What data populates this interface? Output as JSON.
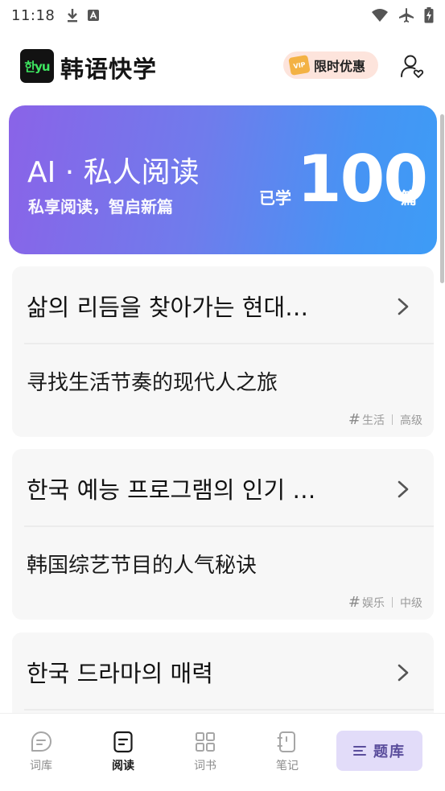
{
  "status_bar": {
    "time": "11:18",
    "left_icons": [
      "download-icon",
      "app-notification-icon"
    ],
    "right_icons": [
      "wifi-icon",
      "airplane-mode-icon",
      "battery-charging-icon"
    ]
  },
  "header": {
    "logo_text": "한yu",
    "app_title": "韩语快学",
    "promo_badge": "VIP",
    "promo_label": "限时优惠"
  },
  "ai_banner": {
    "title": "AI · 私人阅读",
    "subtitle": "私享阅读，智启新篇",
    "learned_prefix": "已学",
    "learned_count": "100",
    "learned_unit": "篇"
  },
  "articles": [
    {
      "korean": "삶의 리듬을 찾아가는 현대…",
      "chinese": "寻找生活节奏的现代人之旅",
      "category": "生活",
      "level": "高级"
    },
    {
      "korean": "한국 예능 프로그램의 인기 …",
      "chinese": "韩国综艺节目的人气秘诀",
      "category": "娱乐",
      "level": "中级"
    },
    {
      "korean": "한국 드라마의 매력",
      "chinese": "",
      "category": "",
      "level": ""
    }
  ],
  "bottom_nav": {
    "items": [
      {
        "label": "词库",
        "icon": "chat-bubble-icon"
      },
      {
        "label": "阅读",
        "icon": "document-icon"
      },
      {
        "label": "词书",
        "icon": "grid-icon"
      },
      {
        "label": "笔记",
        "icon": "notebook-icon"
      }
    ],
    "active_index": 1,
    "bank_button_label": "题库"
  },
  "colors": {
    "banner_start": "#8a63e8",
    "banner_end": "#3d9cf6",
    "logo_green": "#3ee660",
    "bank_button_bg": "#e2dcf9",
    "promo_bg": "#fde4dc"
  }
}
